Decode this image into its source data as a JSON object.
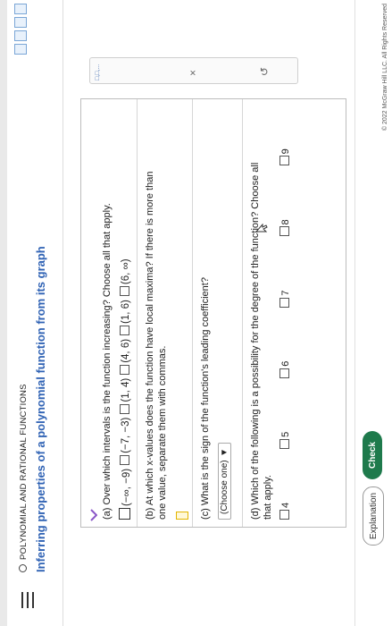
{
  "header": {
    "breadcrumb": "POLYNOMIAL AND RATIONAL FUNCTIONS",
    "title": "Inferring properties of a polynomial function from its graph"
  },
  "questions": {
    "a": {
      "prompt": "(a) Over which intervals is the function increasing? Choose all that apply.",
      "options": [
        "(−∞, −9)",
        "(−7, −3)",
        "(1, 4)",
        "(4, 6)",
        "(1, 6)",
        "(6, ∞)"
      ]
    },
    "b": {
      "prompt_line1": "(b) At which x-values does the function have local maxima? If there is more than",
      "prompt_line2": "one value, separate them with commas."
    },
    "c": {
      "prompt": "(c) What is the sign of the function's leading coefficient?",
      "select_value": "(Choose one)"
    },
    "d": {
      "prompt_line1": "(d) Which of the following is a possibility for the degree of the function? Choose all",
      "prompt_line2": "that apply.",
      "options": [
        "4",
        "5",
        "6",
        "7",
        "8",
        "9"
      ]
    }
  },
  "side_panel": {
    "tools_label": "□,□,...",
    "clear_symbol": "×",
    "undo_symbol": "↺"
  },
  "footer": {
    "explanation_label": "Explanation",
    "check_label": "Check",
    "copyright": "© 2022 McGraw Hill LLC. All Rights Reserved"
  }
}
